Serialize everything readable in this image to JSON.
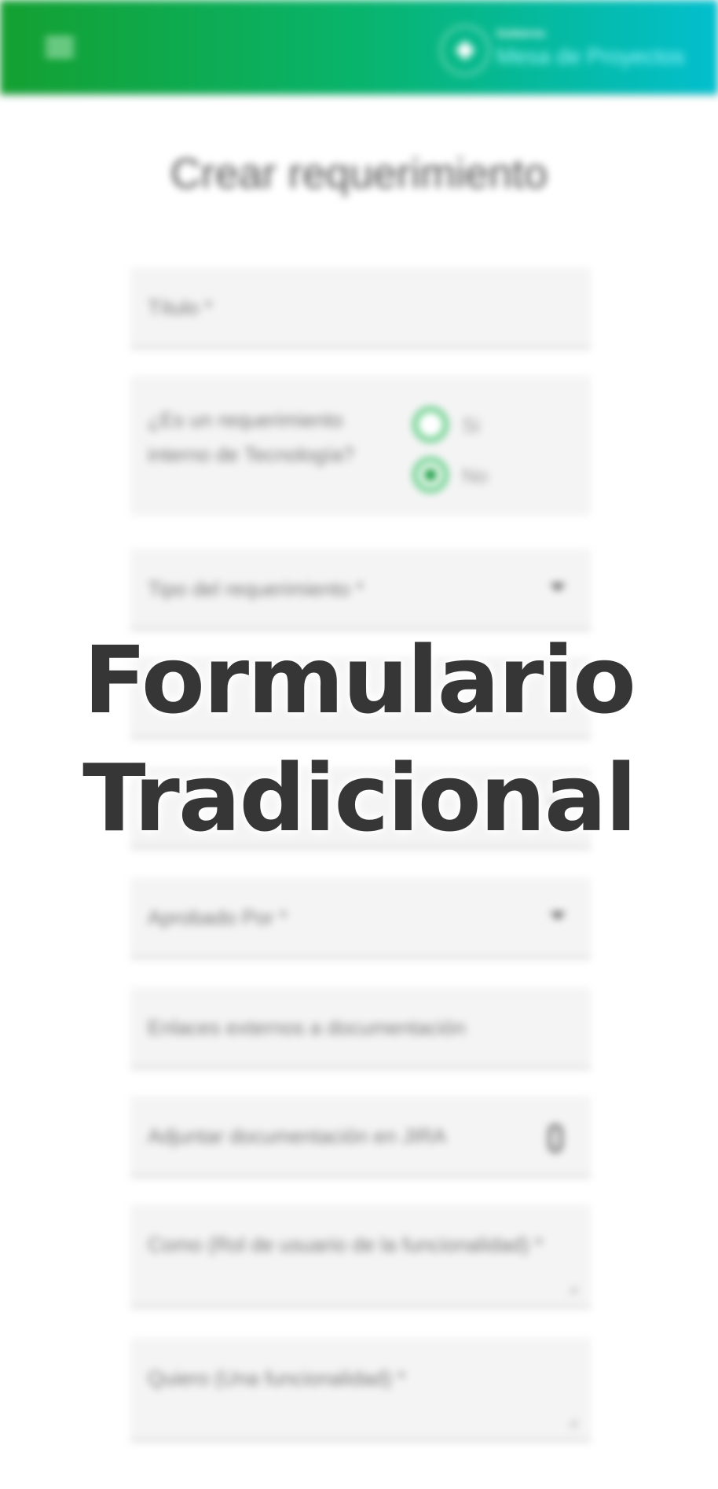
{
  "header": {
    "menu_icon": "hamburger-menu-icon",
    "brand_top": "Gobierno",
    "brand_sub": "Mesa de Proyectos"
  },
  "page": {
    "title": "Crear requerimiento"
  },
  "form": {
    "titulo_label": "Título *",
    "interno_question": "¿Es un requerimiento interno de Tecnología?",
    "interno_options": [
      {
        "label": "Si",
        "selected": false
      },
      {
        "label": "No",
        "selected": true
      }
    ],
    "tipo_label": "Tipo del requerimiento *",
    "aprobado_label": "Aprobado Por *",
    "enlaces_label": "Enlaces externos a documentación",
    "adjuntar_label": "Adjuntar documentación en JIRA",
    "como_label": "Como (Rol de usuario de la funcionalidad) *",
    "quiero_label": "Quiero (Una funcionalidad) *"
  },
  "overlay": {
    "line1": "Formulario",
    "line2": "Tradicional"
  },
  "colors": {
    "header_start": "#14a031",
    "header_end": "#02bfce",
    "radio_accent": "#0f9a3a"
  }
}
